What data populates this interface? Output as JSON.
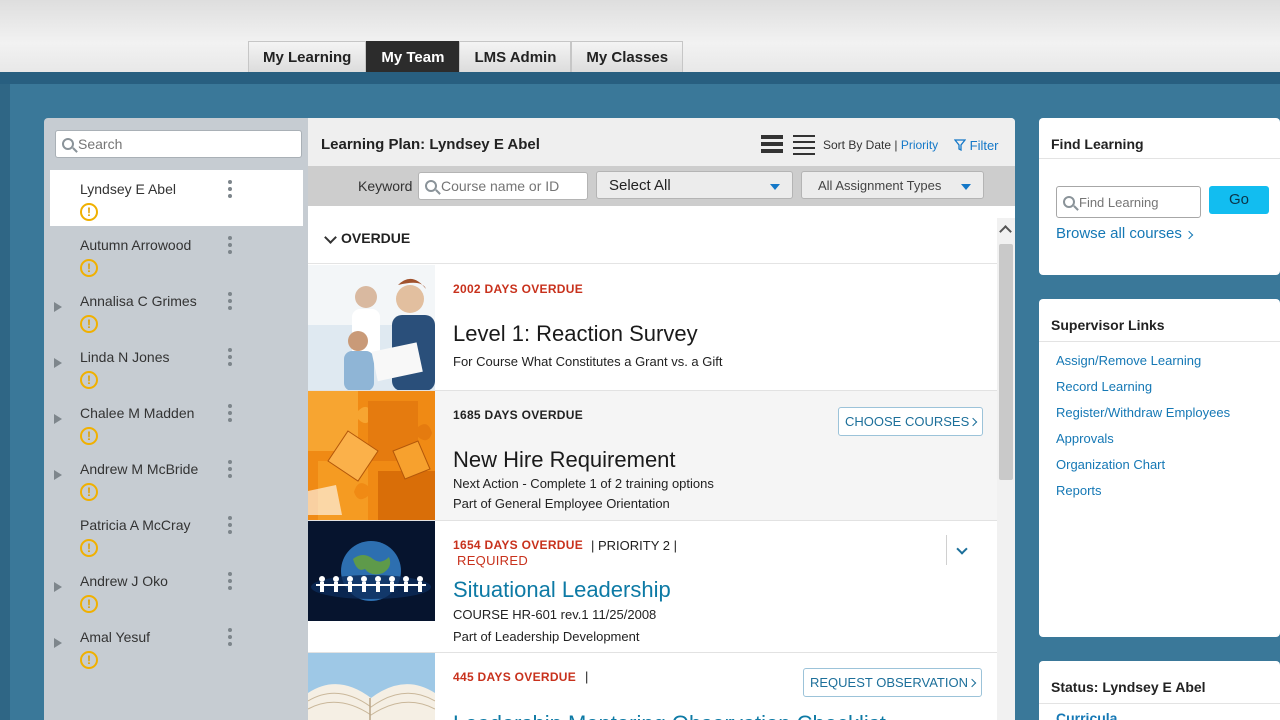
{
  "tabs": [
    {
      "label": "My Learning"
    },
    {
      "label": "My Team"
    },
    {
      "label": "LMS Admin"
    },
    {
      "label": "My Classes"
    }
  ],
  "left": {
    "search_placeholder": "Search",
    "people": [
      {
        "name": "Lyndsey E Abel",
        "status": "!"
      },
      {
        "name": "Autumn Arrowood",
        "status": "!"
      },
      {
        "name": "Annalisa C Grimes",
        "status": "!"
      },
      {
        "name": "Linda N Jones",
        "status": "!"
      },
      {
        "name": "Chalee M Madden",
        "status": "!"
      },
      {
        "name": "Andrew M McBride",
        "status": "!"
      },
      {
        "name": "Patricia A McCray",
        "status": "!"
      },
      {
        "name": "Andrew J Oko",
        "status": "!"
      },
      {
        "name": "Amal Yesuf",
        "status": "!"
      }
    ]
  },
  "center": {
    "plan_title": "Learning Plan: Lyndsey E Abel",
    "sort_prefix": "Sort By Date |",
    "sort_priority": "Priority",
    "filter": "Filter",
    "keyword_label": "Keyword",
    "keyword_placeholder": "Course name or ID",
    "select_status": "Select All",
    "select_type": "All Assignment Types",
    "section_label": "OVERDUE",
    "items": [
      {
        "due": "2002 DAYS OVERDUE",
        "title": "Level 1: Reaction Survey",
        "sub1": "For Course What Constitutes a Grant vs. a Gift"
      },
      {
        "due": "1685 DAYS OVERDUE",
        "title": "New Hire Requirement",
        "sub1": "Next Action - Complete 1 of 2 training options",
        "sub2": "Part of General Employee Orientation",
        "button": "CHOOSE COURSES"
      },
      {
        "due": "1654 DAYS OVERDUE",
        "priority": "|  PRIORITY 2  |",
        "required": "REQUIRED",
        "title": "Situational Leadership",
        "sub1": "COURSE HR-601 rev.1 11/25/2008",
        "sub2": "Part of Leadership Development"
      },
      {
        "due": "445 DAYS OVERDUE",
        "priority": "|",
        "title": "Leadership Mentoring Observation Checklist",
        "button": "REQUEST OBSERVATION"
      }
    ]
  },
  "find": {
    "title": "Find Learning",
    "placeholder": "Find Learning",
    "go": "Go",
    "browse": "Browse all courses"
  },
  "supervisor": {
    "title": "Supervisor Links",
    "links": [
      "Assign/Remove Learning",
      "Record Learning",
      "Register/Withdraw Employees",
      "Approvals",
      "Organization Chart",
      "Reports"
    ]
  },
  "status": {
    "title": "Status: Lyndsey E Abel",
    "curricula": "Curricula"
  },
  "colors": {
    "overdue_red": "#c8311c",
    "link_blue": "#1578b5",
    "go_button": "#12bdf0",
    "active_tab": "#2c2c2c"
  }
}
